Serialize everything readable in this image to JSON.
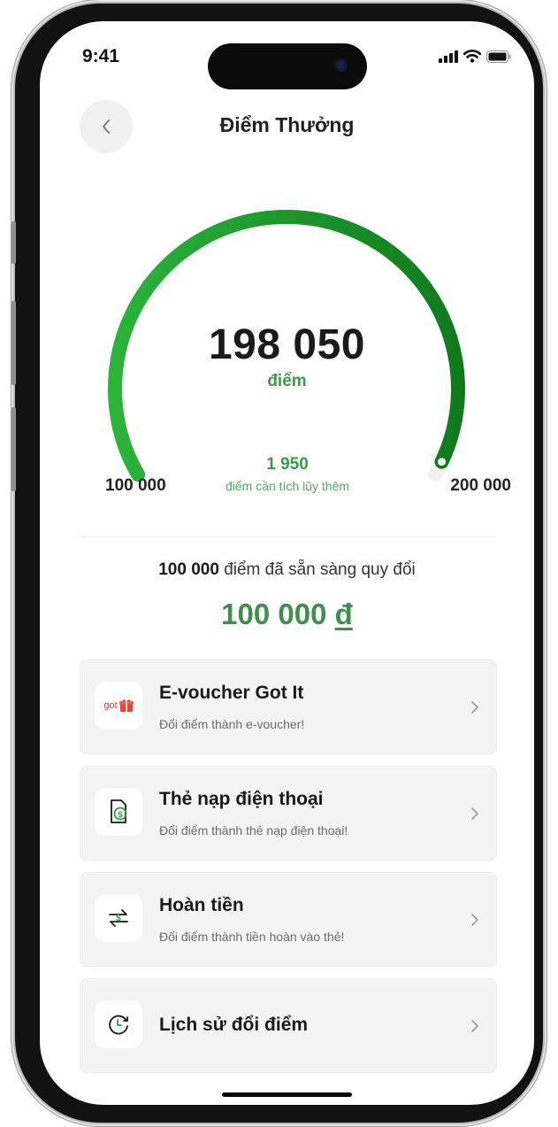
{
  "status": {
    "time": "9:41"
  },
  "header": {
    "title": "Điểm Thưởng"
  },
  "gauge": {
    "points": "198 050",
    "unit": "điểm",
    "min_label": "100 000",
    "max_label": "200 000",
    "points_needed": "1 950",
    "points_needed_text": "điểm cần tích lũy thêm",
    "progress": 0.98,
    "accent_color": "#2bb43a",
    "dark_color": "#0f7a1c"
  },
  "redeem": {
    "ready_points": "100 000",
    "ready_text": "điểm đã sẵn sàng quy đổi",
    "money_value": "100 000",
    "money_currency": "đ"
  },
  "options": [
    {
      "title": "E-voucher Got It",
      "subtitle": "Đổi điểm thành e-voucher!",
      "icon": "gotit-logo-icon",
      "logo_text": "got"
    },
    {
      "title": "Thẻ nạp điện thoại",
      "subtitle": "Đổi điểm thành thẻ nạp điện thoại!",
      "icon": "phone-topup-icon"
    },
    {
      "title": "Hoàn tiền",
      "subtitle": "Đổi điểm thành tiền hoàn vào thẻ!",
      "icon": "cashback-icon"
    },
    {
      "title": "Lịch sử đổi điểm",
      "subtitle": "",
      "icon": "history-icon"
    }
  ]
}
